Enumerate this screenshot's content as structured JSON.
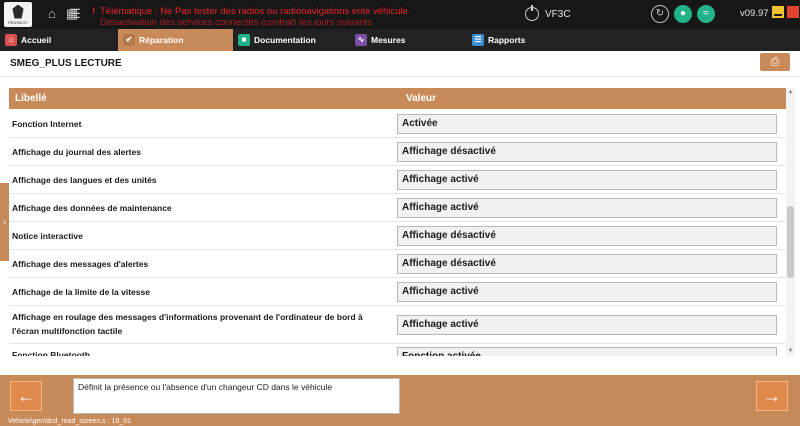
{
  "topbar": {
    "logo_text": "PEUGEOT",
    "alert_line1": "Télématique : Ne Pas tester des radios ou radionavigations ente véhicule.",
    "alert_line2": "Desactivation des services connectés (contrat) les jours suivants",
    "vin": "VF3C",
    "version": "v09.97",
    "icons": [
      "home-icon",
      "grid-icon",
      "list-icon",
      "power-icon",
      "refresh-icon",
      "user-icon",
      "wifi-icon",
      "usb-icon"
    ]
  },
  "nav": {
    "tabs": [
      {
        "label": "Accueil",
        "icon": "home-icon",
        "color": "#d9534f"
      },
      {
        "label": "Réparation",
        "icon": "wrench-icon",
        "color": "#c98a5a"
      },
      {
        "label": "Documentation",
        "icon": "book-icon",
        "color": "#23b38a"
      },
      {
        "label": "Mesures",
        "icon": "waveform-icon",
        "color": "#7b4fa6"
      },
      {
        "label": "Rapports",
        "icon": "report-icon",
        "color": "#3a8fd1"
      }
    ],
    "active": "Réparation"
  },
  "page": {
    "title": "SMEG_PLUS LECTURE"
  },
  "table": {
    "col_label": "Libellé",
    "col_value": "Valeur",
    "rows": [
      {
        "label": "Fonction Internet",
        "value": "Activée"
      },
      {
        "label": "Affichage du journal des alertes",
        "value": "Affichage désactivé"
      },
      {
        "label": "Affichage des langues et des unités",
        "value": "Affichage activé"
      },
      {
        "label": "Affichage des données de maintenance",
        "value": "Affichage activé"
      },
      {
        "label": "Notice interactive",
        "value": "Affichage désactivé"
      },
      {
        "label": "Affichage des messages d'alertes",
        "value": "Affichage désactivé"
      },
      {
        "label": "Affichage de la limite de la vitesse",
        "value": "Affichage activé"
      },
      {
        "label": "Affichage en roulage des messages d'informations provenant de l'ordinateur de bord à l'écran multifonction tactile",
        "value": "Affichage activé"
      },
      {
        "label": "Fonction Bluetooth",
        "value": "Fonction activée"
      }
    ]
  },
  "footer": {
    "description": "Définit la présence ou l'absence d'un changeur CD dans le véhicule",
    "prev_icon": "arrow-left-icon",
    "next_icon": "arrow-right-icon"
  },
  "status": {
    "path": "Vehicle\\gen\\dcd_read_screen.s : 18_01"
  },
  "colors": {
    "accent": "#c98a5a",
    "topbar": "#171717",
    "alert": "#e8242a",
    "ok": "#23b38a"
  }
}
